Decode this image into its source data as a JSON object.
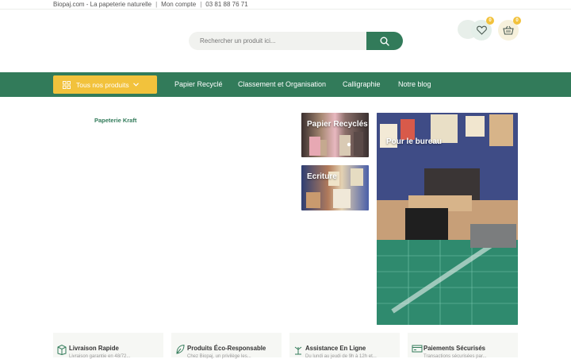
{
  "topbar": {
    "tagline": "Biopaj.com - La papeterie naturelle",
    "account": "Mon compte",
    "phone": "03 81 88 76 71"
  },
  "search": {
    "placeholder": "Rechercher un produit ici..."
  },
  "header": {
    "wishlist_count": "0",
    "cart_count": "0"
  },
  "nav": {
    "all_products": "Tous nos produits",
    "links": [
      "Papier Recyclé",
      "Classement et Organisation",
      "Calligraphie",
      "Notre blog"
    ]
  },
  "sidebar": {
    "first_item": "Papeterie Kraft"
  },
  "tiles": [
    {
      "title": "Papier Recyclés"
    },
    {
      "title": "Ecriture"
    },
    {
      "title": "Pour le bureau"
    }
  ],
  "features": [
    {
      "title": "Livraison Rapide",
      "sub": "Livraison garantie en 48/72..."
    },
    {
      "title": "Produits Éco-Responsable",
      "sub": "Chez Biopaj, un privilège les..."
    },
    {
      "title": "Assistance En Ligne",
      "sub": "Du lundi au jeudi de 9h à 12h et..."
    },
    {
      "title": "Paiements Sécurisés",
      "sub": "Transactions sécurisées par..."
    }
  ],
  "colors": {
    "brand_green": "#327b5a",
    "accent_yellow": "#f2c23c"
  }
}
